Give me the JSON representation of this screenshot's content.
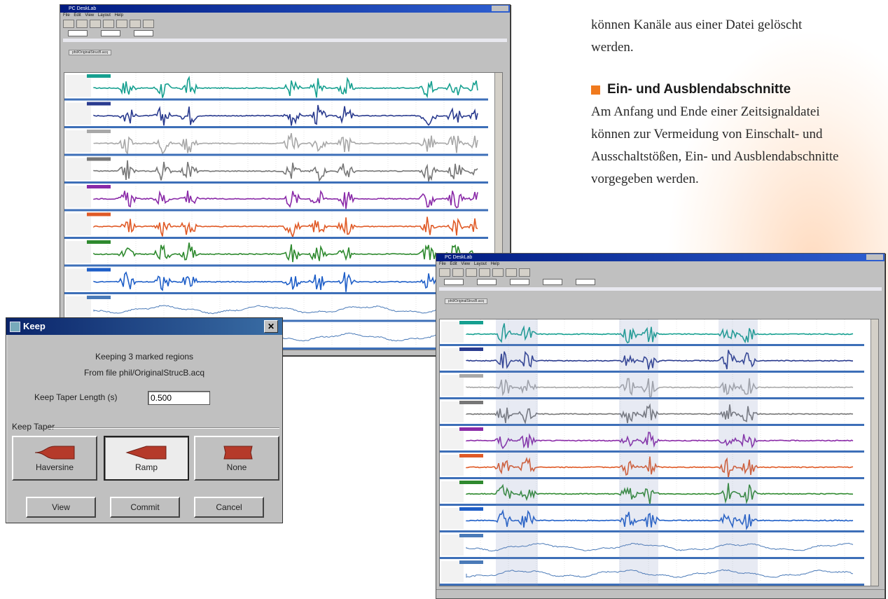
{
  "article": {
    "intro_line1": "können Kanäle aus einer Datei gelöscht",
    "intro_line2": "werden.",
    "heading": "Ein- und Ausblendabschnitte",
    "body": [
      "Am Anfang und Ende einer Zeitsignaldatei",
      "können zur Vermeidung von Einschalt- und",
      "Ausschaltstößen, Ein- und Ausblendabschnitte",
      "vorgegeben werden."
    ]
  },
  "colors": {
    "bullet": "#f07a1e",
    "separator": "#3d6fb8"
  },
  "window_top": {
    "title": "PC DeskLab",
    "menu": "File Edit View Layout Help",
    "tab": "phil/OriginalStrucB.acq"
  },
  "window_bottom": {
    "title": "PC DeskLab",
    "menu": "File Edit View Layout Help",
    "tab": "phil/OriginalStrucB.acq"
  },
  "channels": [
    "#16a090",
    "#2a3b8f",
    "#a8a8a8",
    "#777777",
    "#8a2aa8",
    "#e05a26",
    "#2f8a2f",
    "#1f5fc8",
    "#4a7ab8",
    "#4a7ab8"
  ],
  "keep_dialog": {
    "title": "Keep",
    "info_line1": "Keeping 3 marked regions",
    "info_line2": "From file phil/OriginalStrucB.acq",
    "length_label": "Keep Taper Length (s)",
    "length_value": "0.500",
    "group_label": "Keep Taper",
    "tapers": [
      "Haversine",
      "Ramp",
      "None"
    ],
    "buttons": [
      "View",
      "Commit",
      "Cancel"
    ]
  }
}
